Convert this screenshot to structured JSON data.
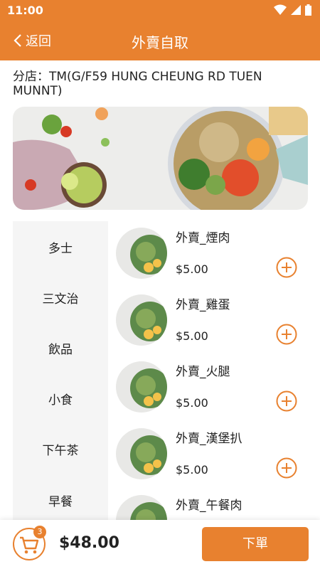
{
  "status_bar": {
    "time": "11:00"
  },
  "header": {
    "back_label": "返回",
    "title": "外賣自取"
  },
  "branch": {
    "text": "分店：TM(G/F59 HUNG CHEUNG RD TUEN MUNNT)"
  },
  "categories": [
    "多士",
    "三文治",
    "飲品",
    "小食",
    "下午茶",
    "早餐"
  ],
  "products": [
    {
      "name": "外賣_煙肉",
      "price": "$5.00"
    },
    {
      "name": "外賣_雞蛋",
      "price": "$5.00"
    },
    {
      "name": "外賣_火腿",
      "price": "$5.00"
    },
    {
      "name": "外賣_漢堡扒",
      "price": "$5.00"
    },
    {
      "name": "外賣_午餐肉",
      "price": ""
    }
  ],
  "cart": {
    "count": "3",
    "total": "$48.00",
    "order_label": "下單"
  },
  "colors": {
    "accent": "#e8812f"
  }
}
